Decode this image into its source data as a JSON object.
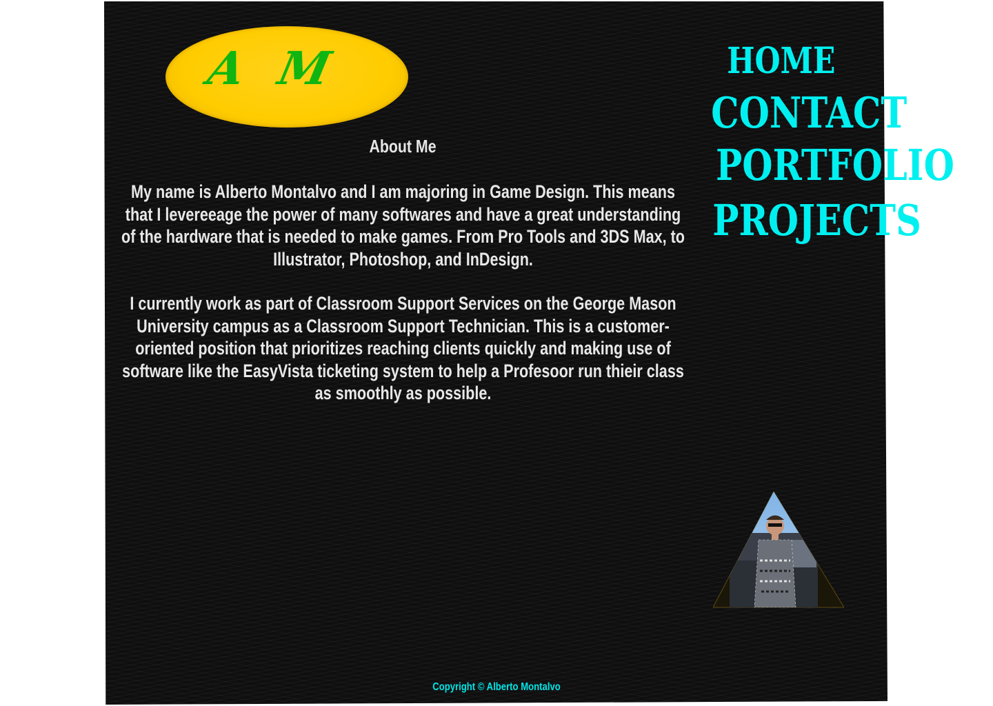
{
  "logo": {
    "text": "A M",
    "colors": {
      "oval": "#ffcc00",
      "letters": "#11b511"
    }
  },
  "about": {
    "heading": "About Me",
    "paragraphs": [
      "My name is Alberto Montalvo and I am majoring in Game Design. This means that I levereeage the power of many softwares and have a great understanding of the hardware that is needed to make games. From Pro Tools and 3DS Max, to Illustrator, Photoshop, and InDesign.",
      "I currently work as part of Classroom Support Services on the George Mason University campus as a Classroom Support Technician. This is a customer-oriented position that prioritizes reaching clients quickly and making use of software like the EasyVista ticketing system to help a Profesoor run thieir class as smoothly as possible."
    ]
  },
  "nav": {
    "items": [
      {
        "label": "HOME"
      },
      {
        "label": "CONTACT"
      },
      {
        "label": "PORTFOLIO"
      },
      {
        "label": "PROJECTS"
      }
    ],
    "color": "#00f0f0"
  },
  "profile": {
    "icon": "profile-photo-triangle"
  },
  "footer": {
    "copyright": "Copyright © Alberto Montalvo"
  },
  "colors": {
    "background": "#0f0f10",
    "text": "#e8e8e8",
    "accent": "#00f0f0"
  }
}
